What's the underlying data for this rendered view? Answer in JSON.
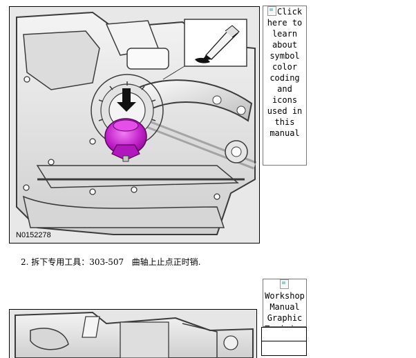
{
  "figure1": {
    "id": "N0152278"
  },
  "side_link1": {
    "text": "Click here to learn about symbol color coding and icons used in this manual"
  },
  "step": {
    "number": "2.",
    "text": "拆下专用工具：303-507   曲轴上止点正时销."
  },
  "side_link2": {
    "text": "Workshop Manual Graphic Training"
  },
  "colors": {
    "bolt_highlight": "#c020c8",
    "figure_bg": "#ececec",
    "line_art": "#3a3a3a"
  }
}
